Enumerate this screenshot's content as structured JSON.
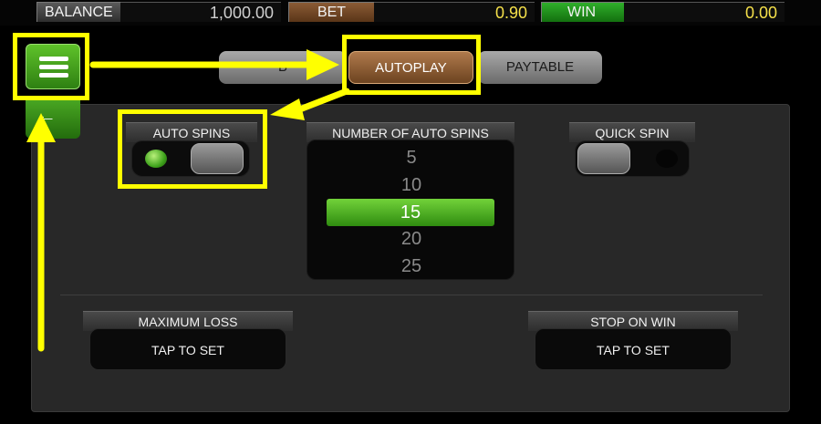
{
  "topbar": {
    "balance_label": "BALANCE",
    "balance_value": "1,000.00",
    "bet_label": "BET",
    "bet_value": "0.90",
    "win_label": "WIN",
    "win_value": "0.00"
  },
  "nav": {
    "menu_icon": "hamburger-menu-icon",
    "back_icon": "back-arrow-icon"
  },
  "tabs": [
    {
      "label": "B",
      "active": false
    },
    {
      "label": "AUTOPLAY",
      "active": true
    },
    {
      "label": "PAYTABLE",
      "active": false
    }
  ],
  "auto_spins": {
    "title": "AUTO SPINS",
    "enabled": false
  },
  "number_of_auto_spins": {
    "title": "NUMBER OF AUTO SPINS",
    "options": [
      "5",
      "10",
      "15",
      "20",
      "25"
    ],
    "selected": "15"
  },
  "quick_spin": {
    "title": "QUICK SPIN",
    "enabled": false
  },
  "maximum_loss": {
    "title": "MAXIMUM LOSS",
    "button_label": "TAP TO SET"
  },
  "stop_on_win": {
    "title": "STOP ON WIN",
    "button_label": "TAP TO SET"
  },
  "colors": {
    "accent_green": "#3fa31c",
    "autoplay_brown": "#8a5b35",
    "value_yellow": "#f5e04a",
    "tutorial_highlight": "#ffff00"
  }
}
